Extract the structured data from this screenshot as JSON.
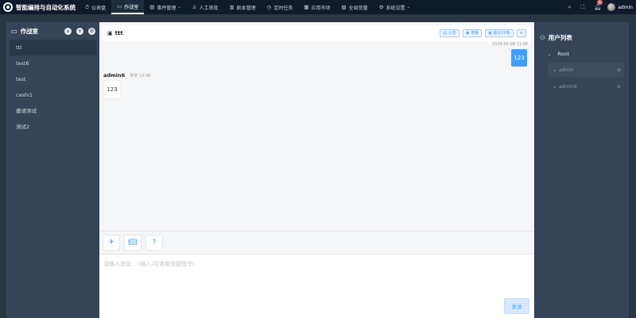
{
  "app": {
    "title": "智能编排与自动化系统"
  },
  "nav": [
    {
      "icon": "⏱",
      "label": "仪表盘",
      "active": false
    },
    {
      "icon": "▭",
      "label": "作战室",
      "active": true
    },
    {
      "icon": "▤",
      "label": "事件管理",
      "active": false,
      "has_dropdown": true
    },
    {
      "icon": "♙",
      "label": "人工审批",
      "active": false
    },
    {
      "icon": "▥",
      "label": "剧本管理",
      "active": false
    },
    {
      "icon": "◷",
      "label": "定时任务",
      "active": false
    },
    {
      "icon": "▦",
      "label": "应用市场",
      "active": false
    },
    {
      "icon": "▨",
      "label": "全局变量",
      "active": false
    },
    {
      "icon": "⚙",
      "label": "系统设置",
      "active": false,
      "has_dropdown": true
    }
  ],
  "top_right": {
    "notification_count": "1",
    "user": "admin"
  },
  "left_panel": {
    "title": "作战室",
    "rooms": [
      "ttt",
      "test6",
      "test",
      "ceshi1",
      "邀请测试",
      "测试2"
    ],
    "active_room": 0
  },
  "chat": {
    "title": "ttt",
    "header_buttons": [
      "公告",
      "搜索",
      "最近20条",
      "⇆"
    ],
    "messages": [
      {
        "side": "right",
        "timestamp": "2025-05-08 11:06",
        "text": "123"
      },
      {
        "side": "left",
        "user": "admin6",
        "timestamp": "昨天 10:48",
        "text": "123"
      }
    ],
    "input_placeholder": "请输入消息... (输入/可查看快捷指令)",
    "send_label": "发送"
  },
  "right_panel": {
    "title": "用户列表",
    "root_label": "Root",
    "users": [
      "admin",
      "admin6"
    ]
  }
}
